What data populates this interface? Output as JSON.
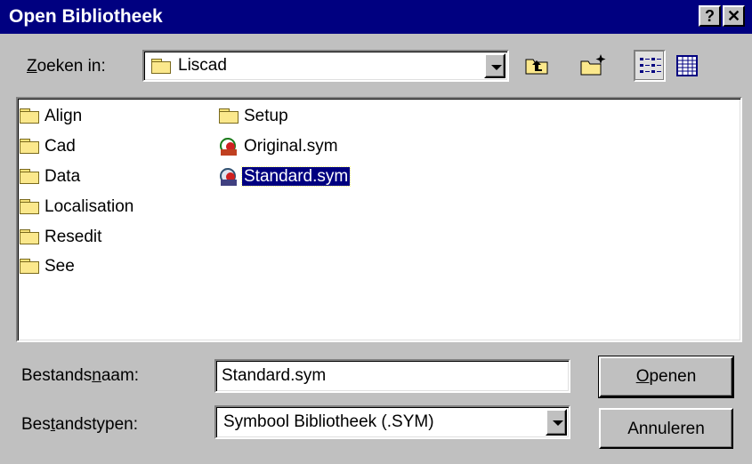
{
  "dialog": {
    "title": "Open Bibliotheek"
  },
  "titlebar_buttons": {
    "help": "?",
    "close": "✕"
  },
  "look_in": {
    "label_pre": "",
    "label_accel": "Z",
    "label_post": "oeken in:",
    "value": "Liscad"
  },
  "toolbar": {
    "icons": [
      "up-one-level-icon",
      "new-folder-icon",
      "list-view-icon",
      "details-view-icon"
    ]
  },
  "files": [
    {
      "name": "Align",
      "type": "folder"
    },
    {
      "name": "Cad",
      "type": "folder"
    },
    {
      "name": "Data",
      "type": "folder"
    },
    {
      "name": "Localisation",
      "type": "folder"
    },
    {
      "name": "Resedit",
      "type": "folder"
    },
    {
      "name": "See",
      "type": "folder"
    },
    {
      "name": "Setup",
      "type": "folder"
    },
    {
      "name": "Original.sym",
      "type": "symbol-library"
    },
    {
      "name": "Standard.sym",
      "type": "symbol-library",
      "selected": true
    }
  ],
  "filename": {
    "label_pre": "Bestands",
    "label_accel": "n",
    "label_post": "aam:",
    "value": "Standard.sym"
  },
  "filetype": {
    "label_pre": "Bes",
    "label_accel": "t",
    "label_post": "andstypen:",
    "value": "Symbool Bibliotheek (.SYM)"
  },
  "buttons": {
    "open_accel": "O",
    "open_rest": "penen",
    "cancel": "Annuleren"
  },
  "colors": {
    "titlebar": "#000080",
    "face": "#c0c0c0",
    "selection": "#000080"
  }
}
